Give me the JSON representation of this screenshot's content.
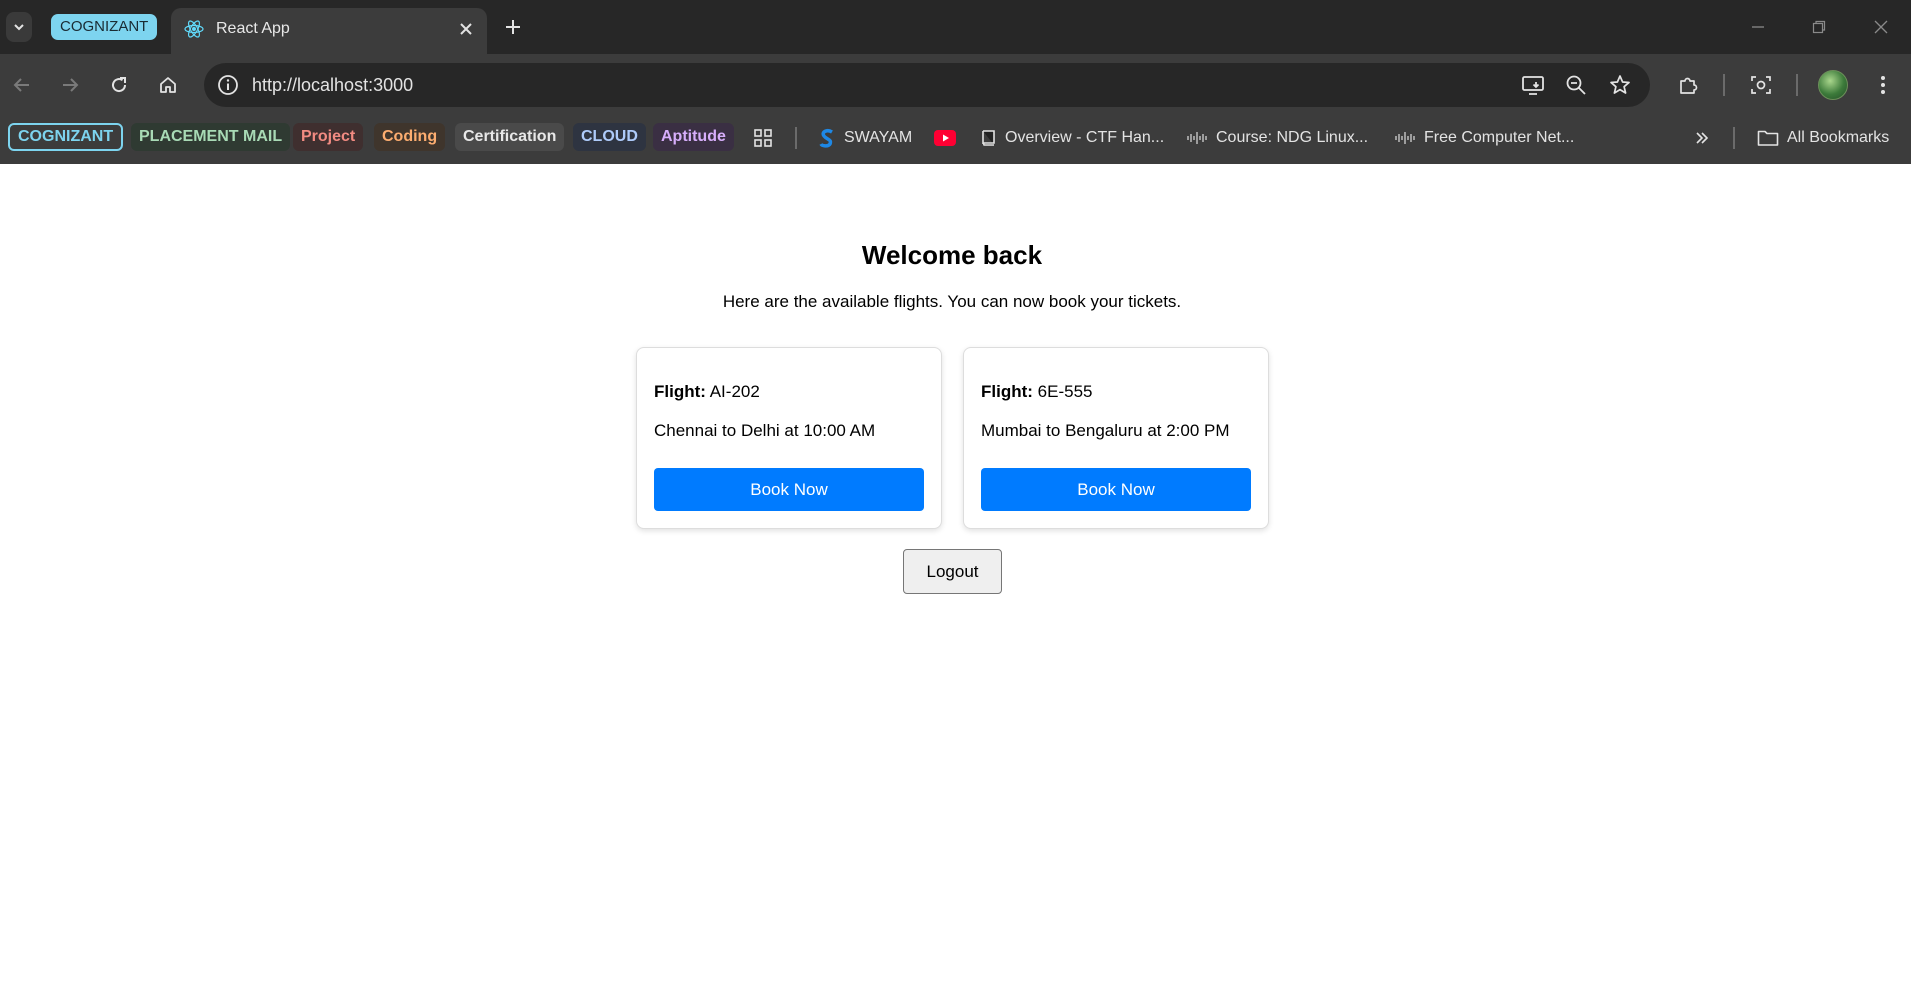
{
  "browser": {
    "tab_group_label": "COGNIZANT",
    "active_tab_title": "React App",
    "url": "http://localhost:3000"
  },
  "bookmarks_bar": {
    "chips": [
      {
        "label": "COGNIZANT",
        "color": "#7dd4ef"
      },
      {
        "label": "PLACEMENT MAIL",
        "color": "#a8dab5"
      },
      {
        "label": "Project",
        "color": "#f28b82"
      },
      {
        "label": "Coding",
        "color": "#fcad70"
      },
      {
        "label": "Certification",
        "color": "#e0e0e0"
      },
      {
        "label": "CLOUD",
        "color": "#aecbfa"
      },
      {
        "label": "Aptitude",
        "color": "#d7aefb"
      }
    ],
    "links": [
      {
        "label": "SWAYAM",
        "icon": "swayam-icon"
      },
      {
        "label": "",
        "icon": "youtube-icon"
      },
      {
        "label": "Overview - CTF Han...",
        "icon": "book-icon"
      },
      {
        "label": "Course: NDG Linux...",
        "icon": "cisco-icon"
      },
      {
        "label": "Free Computer Net...",
        "icon": "cisco-icon"
      }
    ],
    "all_bookmarks_label": "All Bookmarks"
  },
  "page": {
    "heading": "Welcome back",
    "subtitle": "Here are the available flights. You can now book your tickets.",
    "flight_label": "Flight:",
    "flights": [
      {
        "number": "AI-202",
        "route": "Chennai to Delhi at 10:00 AM",
        "button": "Book Now"
      },
      {
        "number": "6E-555",
        "route": "Mumbai to Bengaluru at 2:00 PM",
        "button": "Book Now"
      }
    ],
    "logout_label": "Logout",
    "accent_color": "#007bff"
  }
}
